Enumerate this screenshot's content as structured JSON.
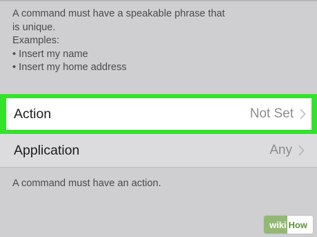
{
  "header": {
    "lines": [
      "A command must have a speakable phrase that",
      "is unique.",
      "Examples:",
      "• Insert my name",
      "• Insert my home address"
    ]
  },
  "rows": {
    "action": {
      "label": "Action",
      "value": "Not Set"
    },
    "application": {
      "label": "Application",
      "value": "Any"
    }
  },
  "footer": {
    "text": "A command must have an action."
  },
  "icons": {
    "row_disclosure": "chevron-right-icon"
  },
  "colors": {
    "highlight": "#33e22b",
    "background": "#cfcfd2",
    "value_text": "#8c8c8f"
  },
  "watermark": {
    "brand": "wikiHow"
  }
}
